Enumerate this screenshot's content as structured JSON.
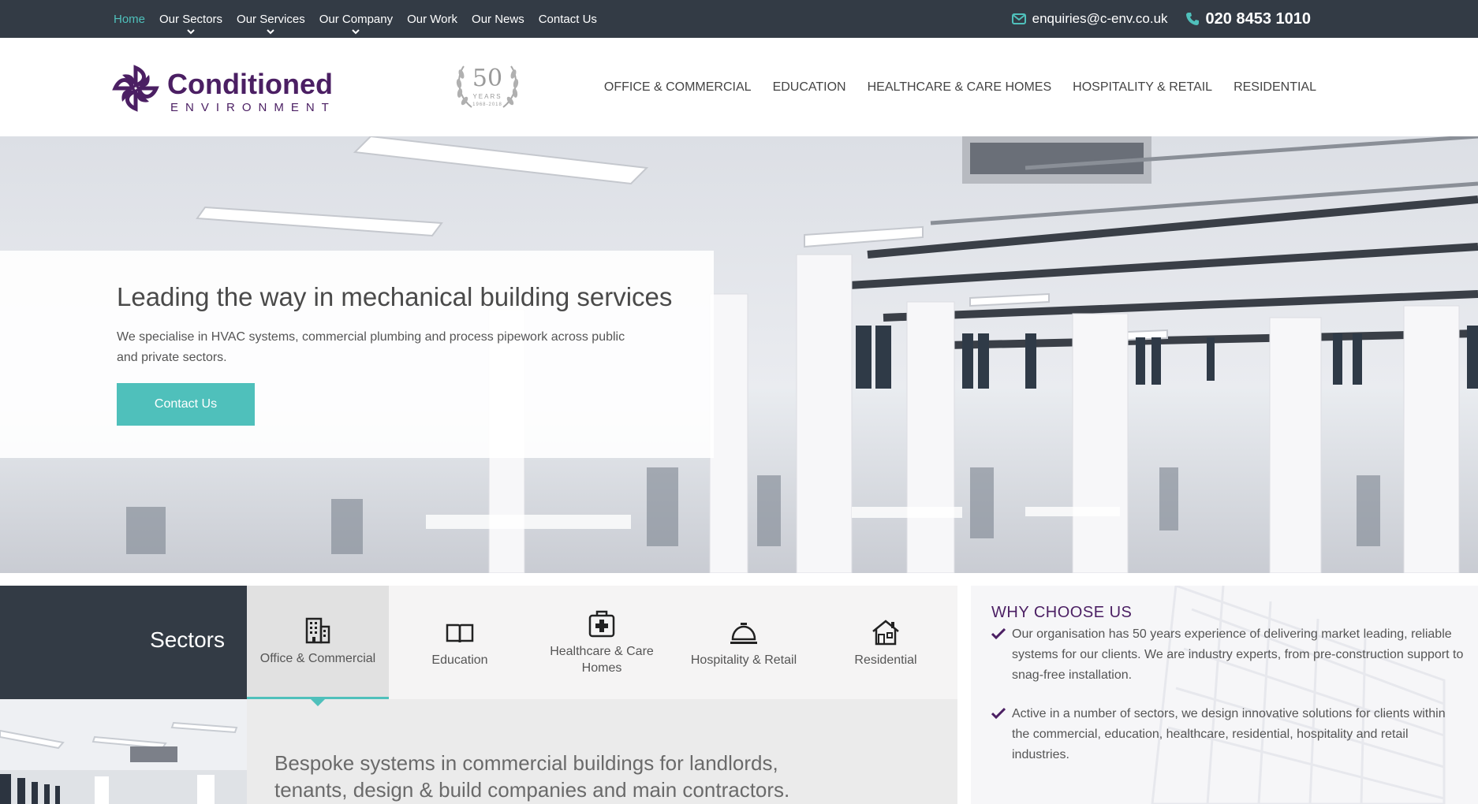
{
  "topbar": {
    "nav": [
      {
        "label": "Home",
        "active": true,
        "dropdown": false
      },
      {
        "label": "Our Sectors",
        "active": false,
        "dropdown": true
      },
      {
        "label": "Our Services",
        "active": false,
        "dropdown": true
      },
      {
        "label": "Our Company",
        "active": false,
        "dropdown": true
      },
      {
        "label": "Our Work",
        "active": false,
        "dropdown": false
      },
      {
        "label": "Our News",
        "active": false,
        "dropdown": false
      },
      {
        "label": "Contact Us",
        "active": false,
        "dropdown": false
      }
    ],
    "email": "enquiries@c-env.co.uk",
    "phone": "020 8453 1010",
    "email_icon": "envelope-icon",
    "phone_icon": "phone-icon"
  },
  "header": {
    "logo_name": "Conditioned",
    "logo_sub": "ENVIRONMENT",
    "badge_number": "50",
    "badge_years": "YEARS",
    "badge_range": "1968-2018",
    "sector_nav": [
      "OFFICE & COMMERCIAL",
      "EDUCATION",
      "HEALTHCARE & CARE HOMES",
      "HOSPITALITY & RETAIL",
      "RESIDENTIAL"
    ]
  },
  "hero": {
    "title": "Leading the way in mechanical building services",
    "text": "We specialise in HVAC systems, commercial plumbing and process pipework across public and private sectors.",
    "button": "Contact Us"
  },
  "sectors": {
    "title": "Sectors",
    "tabs": [
      {
        "label": "Office & Commercial",
        "icon": "office-building-icon",
        "active": true
      },
      {
        "label": "Education",
        "icon": "open-book-icon",
        "active": false
      },
      {
        "label": "Healthcare & Care Homes",
        "icon": "medical-bag-icon",
        "active": false
      },
      {
        "label": "Hospitality & Retail",
        "icon": "service-bell-icon",
        "active": false
      },
      {
        "label": "Residential",
        "icon": "house-icon",
        "active": false
      }
    ],
    "description": "Bespoke systems in commercial buildings for landlords, tenants, design & build companies and main contractors."
  },
  "why": {
    "title": "WHY CHOOSE US",
    "items": [
      "Our organisation has 50 years experience of delivering market leading, reliable systems for our clients. We are industry experts, from pre-construction support to snag-free installation.",
      "Active in a number of sectors, we design innovative solutions for clients within the commercial, education, healthcare, residential, hospitality and retail industries."
    ]
  },
  "colors": {
    "dark": "#333b45",
    "teal": "#4fc0bb",
    "purple": "#4b1f63"
  }
}
